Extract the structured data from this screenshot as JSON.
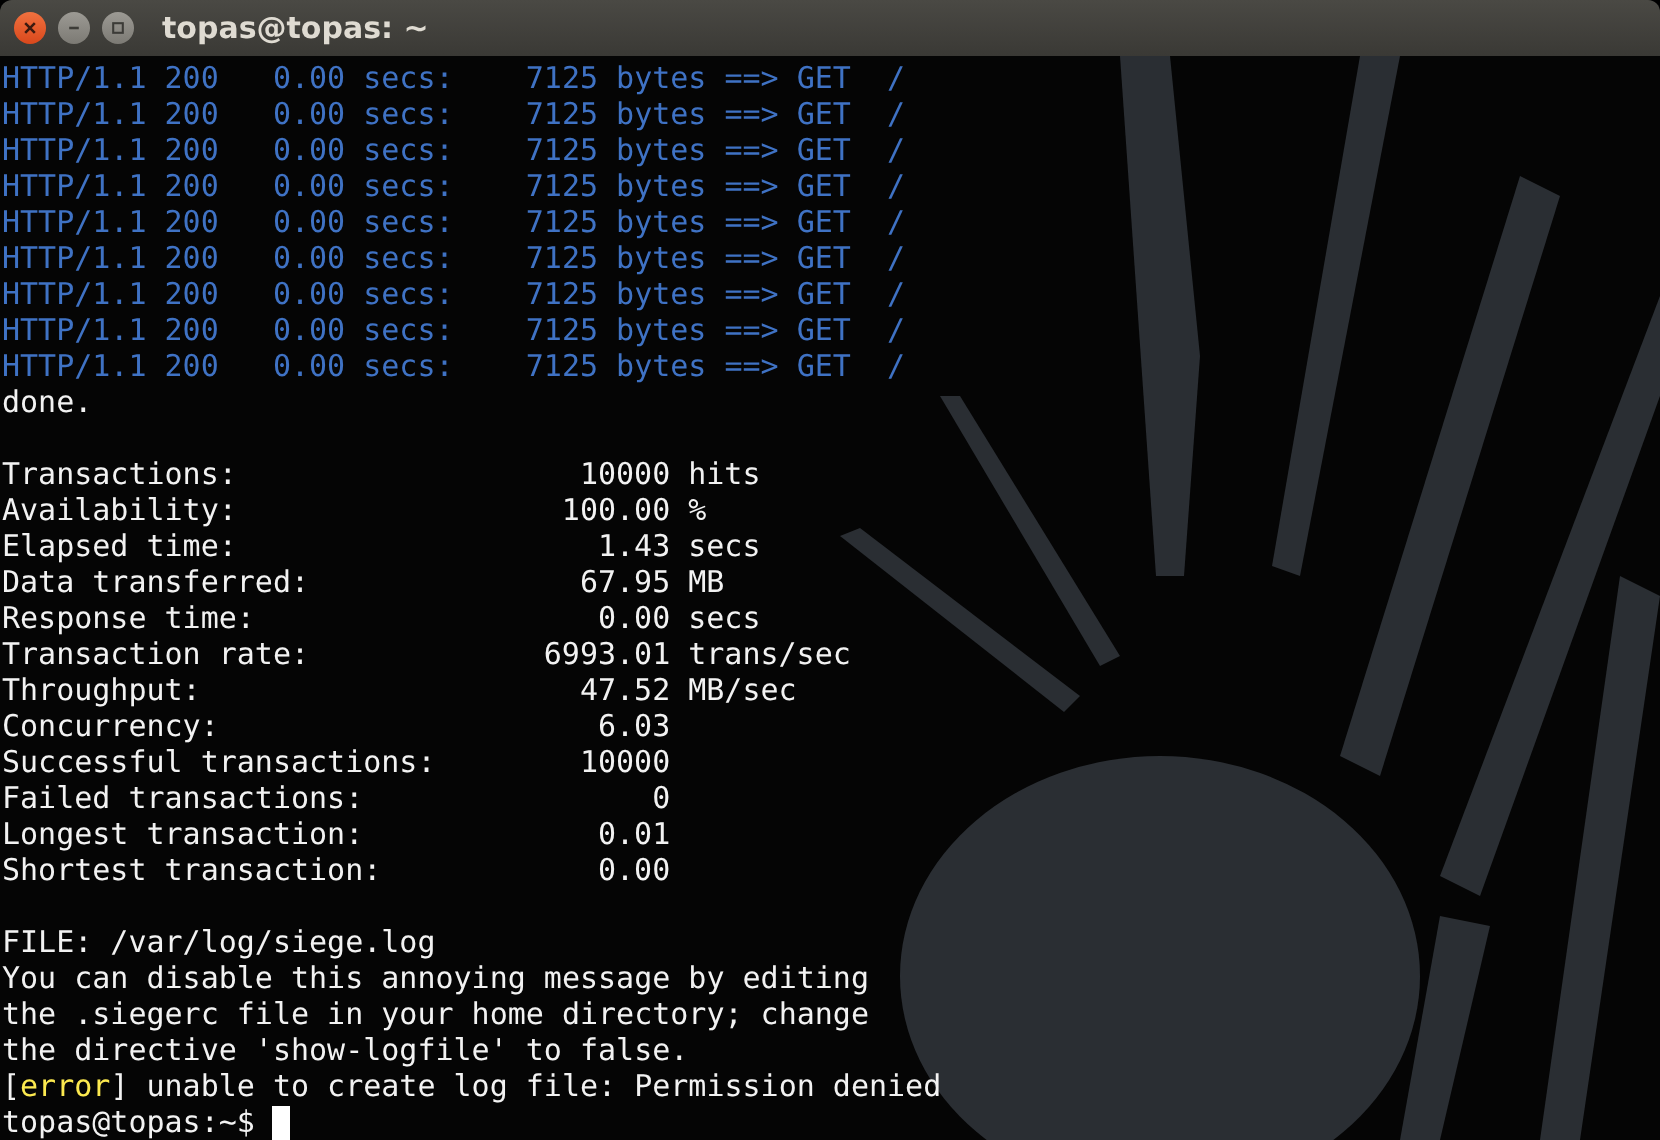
{
  "window": {
    "title": "topas@topas: ~"
  },
  "terminal": {
    "lines": [
      {
        "kind": "http",
        "text": "HTTP/1.1 200   0.00 secs:    7125 bytes ==> GET  /"
      },
      {
        "kind": "http",
        "text": "HTTP/1.1 200   0.00 secs:    7125 bytes ==> GET  /"
      },
      {
        "kind": "http",
        "text": "HTTP/1.1 200   0.00 secs:    7125 bytes ==> GET  /"
      },
      {
        "kind": "http",
        "text": "HTTP/1.1 200   0.00 secs:    7125 bytes ==> GET  /"
      },
      {
        "kind": "http",
        "text": "HTTP/1.1 200   0.00 secs:    7125 bytes ==> GET  /"
      },
      {
        "kind": "http",
        "text": "HTTP/1.1 200   0.00 secs:    7125 bytes ==> GET  /"
      },
      {
        "kind": "http",
        "text": "HTTP/1.1 200   0.00 secs:    7125 bytes ==> GET  /"
      },
      {
        "kind": "http",
        "text": "HTTP/1.1 200   0.00 secs:    7125 bytes ==> GET  /"
      },
      {
        "kind": "http",
        "text": "HTTP/1.1 200   0.00 secs:    7125 bytes ==> GET  /"
      },
      {
        "kind": "plain",
        "text": "done."
      },
      {
        "kind": "blank"
      },
      {
        "kind": "stat",
        "label": "Transactions:",
        "value": "10000",
        "unit": "hits"
      },
      {
        "kind": "stat",
        "label": "Availability:",
        "value": "100.00",
        "unit": "%"
      },
      {
        "kind": "stat",
        "label": "Elapsed time:",
        "value": "1.43",
        "unit": "secs"
      },
      {
        "kind": "stat",
        "label": "Data transferred:",
        "value": "67.95",
        "unit": "MB"
      },
      {
        "kind": "stat",
        "label": "Response time:",
        "value": "0.00",
        "unit": "secs"
      },
      {
        "kind": "stat",
        "label": "Transaction rate:",
        "value": "6993.01",
        "unit": "trans/sec"
      },
      {
        "kind": "stat",
        "label": "Throughput:",
        "value": "47.52",
        "unit": "MB/sec"
      },
      {
        "kind": "stat",
        "label": "Concurrency:",
        "value": "6.03"
      },
      {
        "kind": "stat",
        "label": "Successful transactions:",
        "value": "10000"
      },
      {
        "kind": "stat",
        "label": "Failed transactions:",
        "value": "0"
      },
      {
        "kind": "stat",
        "label": "Longest transaction:",
        "value": "0.01"
      },
      {
        "kind": "stat",
        "label": "Shortest transaction:",
        "value": "0.00"
      },
      {
        "kind": "blank"
      },
      {
        "kind": "plain",
        "text": "FILE: /var/log/siege.log"
      },
      {
        "kind": "plain",
        "text": "You can disable this annoying message by editing"
      },
      {
        "kind": "plain",
        "text": "the .siegerc file in your home directory; change"
      },
      {
        "kind": "plain",
        "text": "the directive 'show-logfile' to false."
      },
      {
        "kind": "mixed",
        "parts": [
          {
            "kind": "plain",
            "text": "["
          },
          {
            "kind": "tag",
            "text": "error"
          },
          {
            "kind": "plain",
            "text": "] unable to create log file: Permission denied"
          }
        ]
      },
      {
        "kind": "prompt",
        "text": "topas@topas:~$"
      }
    ]
  }
}
